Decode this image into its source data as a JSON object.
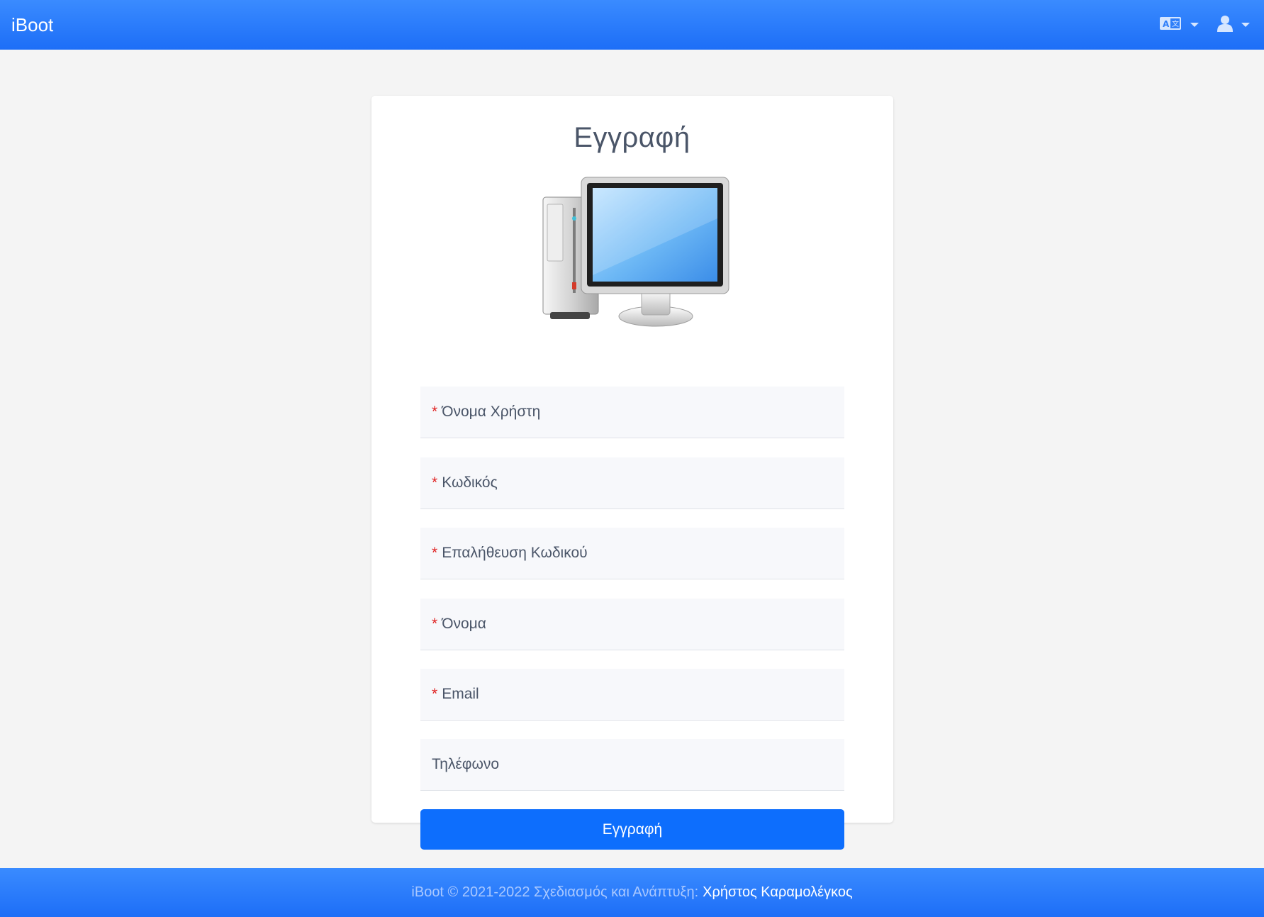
{
  "app": {
    "brand": "iBoot"
  },
  "header": {
    "language_icon": "translate-icon",
    "user_icon": "user-icon",
    "accent": "#1d6ef7"
  },
  "form": {
    "title": "Εγγραφή",
    "illustration_icon": "desktop-computer-icon",
    "fields": [
      {
        "label": "Όνομα Χρήστη",
        "required": "*"
      },
      {
        "label": "Κωδικός",
        "required": "*"
      },
      {
        "label": "Επαλήθευση Κωδικού",
        "required": "*"
      },
      {
        "label": "Όνομα",
        "required": "*"
      },
      {
        "label": "Email",
        "required": "*"
      },
      {
        "label": "Τηλέφωνο",
        "required": ""
      }
    ],
    "submit_label": "Εγγραφή",
    "submit_color": "#0d6efd"
  },
  "footer": {
    "text": "iBoot © 2021-2022 Σχεδιασμός και Ανάπτυξη:",
    "author": "Χρήστος Καραμολέγκος"
  }
}
